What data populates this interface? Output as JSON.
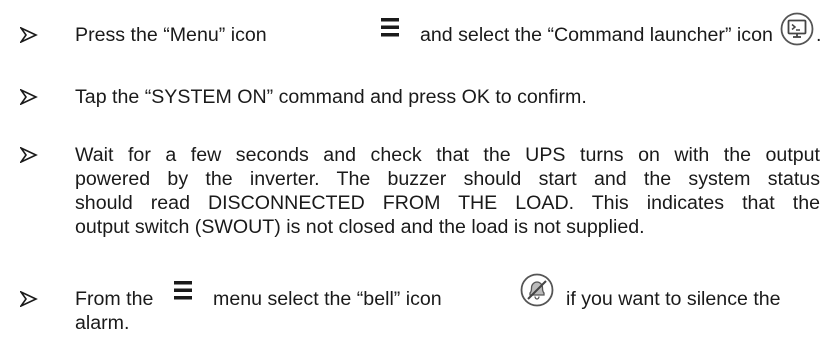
{
  "instructions": [
    {
      "id": "step1",
      "text_before_menu_icon": "Press the “Menu” icon",
      "text_after_menu_icon": "and select the “Command launcher” icon",
      "trailing_punct": ".",
      "icons": [
        "menu-icon",
        "command-launcher-icon"
      ]
    },
    {
      "id": "step2",
      "text": "Tap the “SYSTEM ON” command and press OK to confirm."
    },
    {
      "id": "step3",
      "lines": [
        "Wait for a few seconds and check that the UPS turns on with the output",
        "powered by the inverter. The buzzer should start and the system status",
        "should read DISCONNECTED FROM THE LOAD. This indicates that the",
        "output switch (SWOUT) is not closed and the load is not supplied."
      ]
    },
    {
      "id": "step4",
      "text_before_menu_icon": "From the",
      "text_after_menu_icon": "menu select the “bell” icon",
      "text_after_bell_icon": "if you want to silence the",
      "continuation": "alarm.",
      "icons": [
        "menu-icon",
        "bell-muted-icon"
      ]
    }
  ]
}
